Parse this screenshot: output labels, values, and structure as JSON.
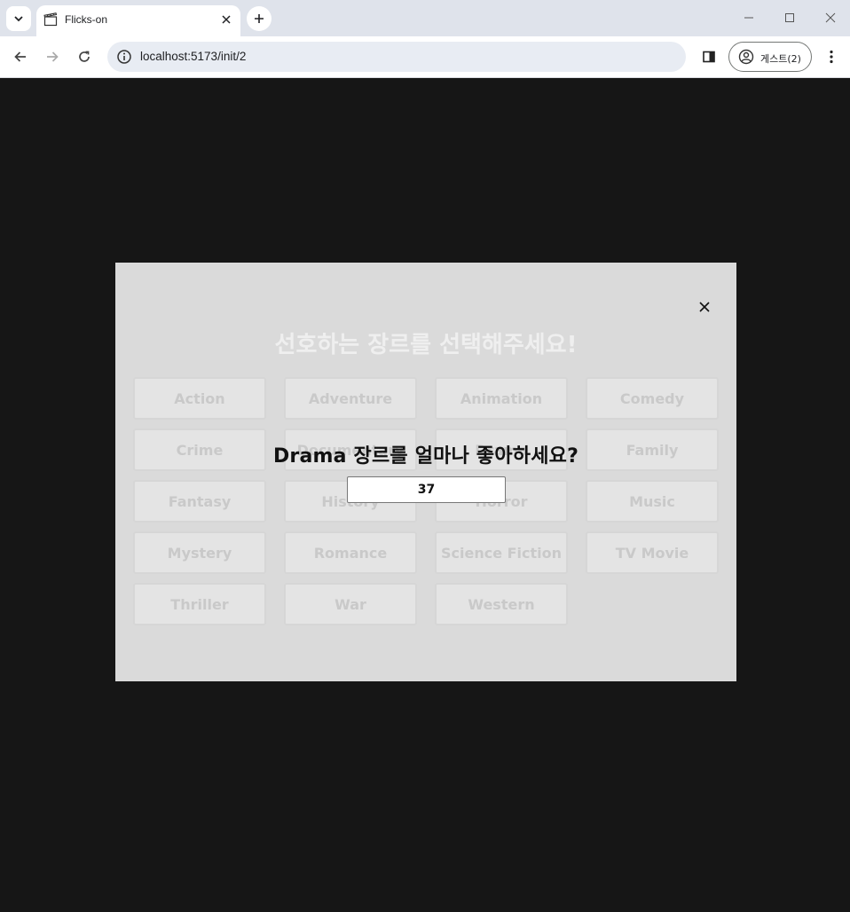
{
  "browser": {
    "tab_title": "Flicks-on",
    "url": "localhost:5173/init/2",
    "profile_label": "게스트(2)"
  },
  "modal": {
    "title": "선호하는 장르를 선택해주세요!",
    "genres": [
      "Action",
      "Adventure",
      "Animation",
      "Comedy",
      "Crime",
      "Documentary",
      "Drama",
      "Family",
      "Fantasy",
      "History",
      "Horror",
      "Music",
      "Mystery",
      "Romance",
      "Science Fiction",
      "TV Movie",
      "Thriller",
      "War",
      "Western"
    ],
    "question": "Drama 장르를 얼마나 좋아하세요?",
    "score_value": "37"
  },
  "colors": {
    "page_bg": "#161616",
    "modal_bg": "#dadada",
    "genre_text": "#c9c9c9"
  }
}
